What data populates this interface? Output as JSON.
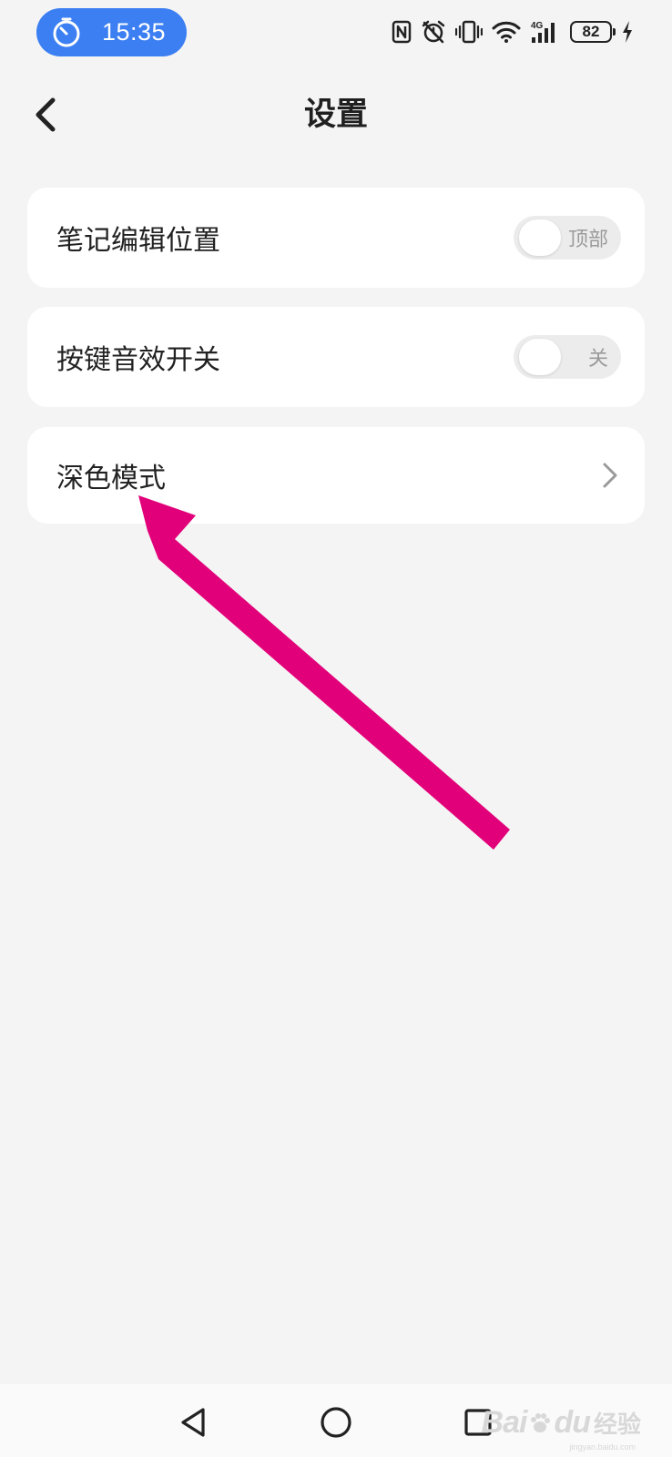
{
  "status_bar": {
    "time": "15:35",
    "battery_level": "82",
    "network_label": "4G",
    "pill_color": "#3b7ff2",
    "icons": [
      "timer-icon",
      "nfc-icon",
      "alarm-icon",
      "vibrate-icon",
      "wifi-icon",
      "signal-icon",
      "battery-icon",
      "charging-icon"
    ]
  },
  "header": {
    "title": "设置",
    "back_icon": "chevron-left-icon"
  },
  "settings": {
    "items": [
      {
        "label": "笔记编辑位置",
        "control": "toggle",
        "toggle_text": "顶部",
        "on": false
      },
      {
        "label": "按键音效开关",
        "control": "toggle",
        "toggle_text": "关",
        "on": false
      },
      {
        "label": "深色模式",
        "control": "chevron"
      }
    ]
  },
  "annotation": {
    "arrow_color": "#e2007a"
  },
  "nav_bar": {
    "buttons": [
      "nav-back-icon",
      "nav-home-icon",
      "nav-recent-icon"
    ]
  },
  "watermark": {
    "brand": "Bai",
    "brand_suffix": "du",
    "cn": "经验",
    "domain": "jingyan.baidu.com"
  }
}
